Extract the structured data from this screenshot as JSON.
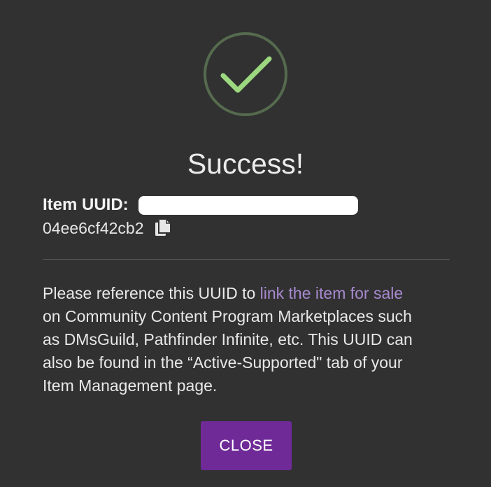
{
  "dialog": {
    "title": "Success!",
    "uuid_label": "Item UUID:",
    "uuid_value": "04ee6cf42cb2",
    "copy_icon": "copy-icon",
    "message": {
      "line1_prefix": "Please reference this UUID to ",
      "line1_link": "link the item for sale",
      "line2": "on Community Content Program Marketplaces such",
      "line3": "as DMsGuild, Pathfinder Infinite, etc. This UUID can",
      "line4": "also be found in the “Active-Supported\" tab of your",
      "line5": "Item Management page."
    },
    "close_label": "CLOSE",
    "colors": {
      "background": "#313131",
      "check_ring": "#556a4e",
      "check_mark": "#9cd87f",
      "link": "#a88ad0",
      "button": "#6f2a98"
    }
  }
}
